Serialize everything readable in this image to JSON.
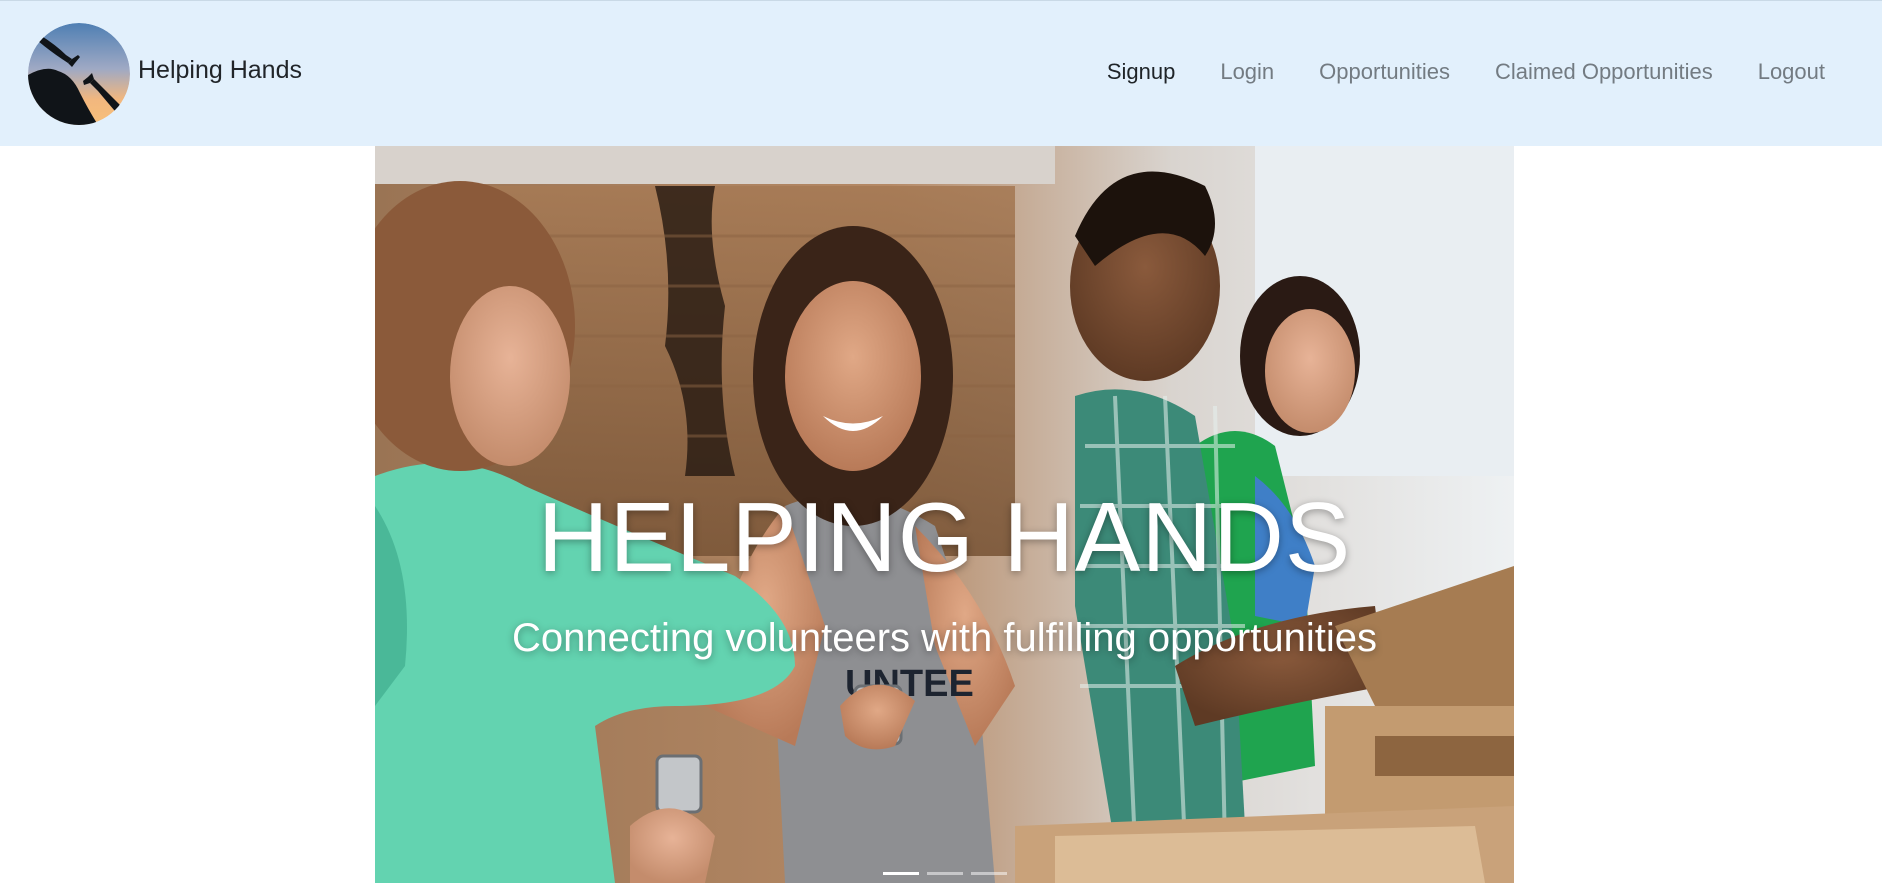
{
  "brand": {
    "name": "Helping Hands",
    "logo_icon": "reaching-hands-logo"
  },
  "nav": {
    "items": [
      {
        "label": "Signup",
        "active": true
      },
      {
        "label": "Login",
        "active": false
      },
      {
        "label": "Opportunities",
        "active": false
      },
      {
        "label": "Claimed Opportunities",
        "active": false
      },
      {
        "label": "Logout",
        "active": false
      }
    ]
  },
  "hero": {
    "title": "HELPING HANDS",
    "subtitle": "Connecting volunteers with fulfilling opportunities",
    "image_subject": "volunteers-packing-food-donation-boxes",
    "slides": 3,
    "active_slide": 1
  },
  "colors": {
    "navbar_bg": "#e2f0fc",
    "nav_link": "#737b82",
    "nav_link_active": "#1f2428",
    "caption_text": "#ffffff"
  }
}
